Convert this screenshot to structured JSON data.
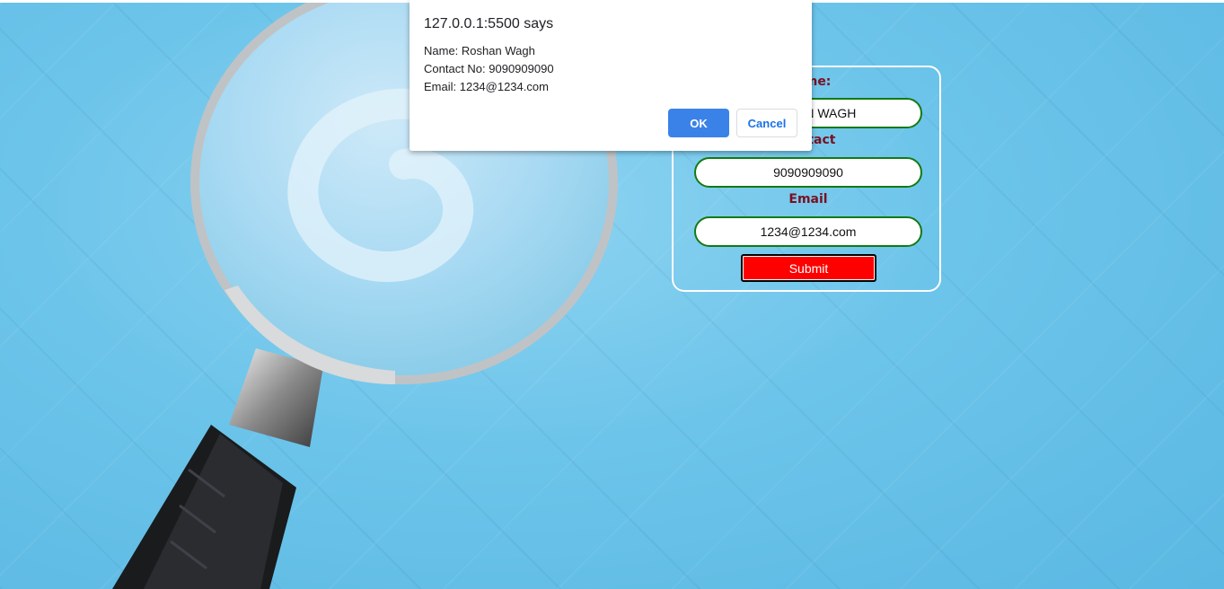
{
  "dialog": {
    "title": "127.0.0.1:5500 says",
    "lines": [
      "Name: Roshan Wagh",
      "Contact No: 9090909090",
      "Email: 1234@1234.com"
    ],
    "ok_label": "OK",
    "cancel_label": "Cancel"
  },
  "form": {
    "name_label": "Name:",
    "name_value": "ROSHAN WAGH",
    "contact_label": "Contact",
    "contact_value": "9090909090",
    "email_label": "Email",
    "email_value": "1234@1234.com",
    "submit_label": "Submit"
  },
  "colors": {
    "background": "#6cc3e8",
    "label": "#7a1020",
    "input_border": "#137a13",
    "submit": "#ff0000",
    "ok_button": "#3b82e8"
  },
  "background_image": {
    "icon": "magnifying-glass"
  }
}
